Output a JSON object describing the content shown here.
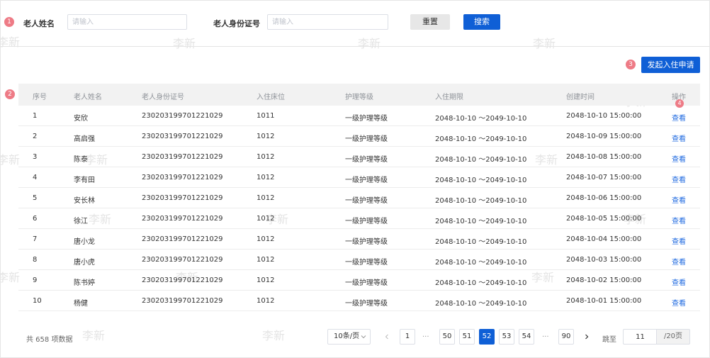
{
  "search": {
    "name_label": "老人姓名",
    "name_placeholder": "请输入",
    "id_label": "老人身份证号",
    "id_placeholder": "请输入",
    "reset_label": "重置",
    "search_label": "搜索"
  },
  "badges": [
    "1",
    "2",
    "3",
    "4"
  ],
  "watermark_text": "李新",
  "apply_button_label": "发起入住申请",
  "table": {
    "headers": [
      "序号",
      "老人姓名",
      "老人身份证号",
      "入住床位",
      "护理等级",
      "入住期限",
      "创建时间",
      "操作"
    ],
    "rows": [
      {
        "no": "1",
        "name": "安欣",
        "id": "230203199701221029",
        "bed": "1011",
        "level": "一级护理等级",
        "term": "2048-10-10 ～2049-10-10",
        "created": "2048-10-10 15:00:00",
        "action": "查看"
      },
      {
        "no": "2",
        "name": "高启强",
        "id": "230203199701221029",
        "bed": "1012",
        "level": "一级护理等级",
        "term": "2048-10-10 ～2049-10-10",
        "created": "2048-10-09 15:00:00",
        "action": "查看"
      },
      {
        "no": "3",
        "name": "陈泰",
        "id": "230203199701221029",
        "bed": "1012",
        "level": "一级护理等级",
        "term": "2048-10-10 ～2049-10-10",
        "created": "2048-10-08 15:00:00",
        "action": "查看"
      },
      {
        "no": "4",
        "name": "李有田",
        "id": "230203199701221029",
        "bed": "1012",
        "level": "一级护理等级",
        "term": "2048-10-10 ～2049-10-10",
        "created": "2048-10-07 15:00:00",
        "action": "查看"
      },
      {
        "no": "5",
        "name": "安长林",
        "id": "230203199701221029",
        "bed": "1012",
        "level": "一级护理等级",
        "term": "2048-10-10 ～2049-10-10",
        "created": "2048-10-06 15:00:00",
        "action": "查看"
      },
      {
        "no": "6",
        "name": "徐江",
        "id": "230203199701221029",
        "bed": "1012",
        "level": "一级护理等级",
        "term": "2048-10-10 ～2049-10-10",
        "created": "2048-10-05 15:00:00",
        "action": "查看"
      },
      {
        "no": "7",
        "name": "唐小龙",
        "id": "230203199701221029",
        "bed": "1012",
        "level": "一级护理等级",
        "term": "2048-10-10 ～2049-10-10",
        "created": "2048-10-04 15:00:00",
        "action": "查看"
      },
      {
        "no": "8",
        "name": "唐小虎",
        "id": "230203199701221029",
        "bed": "1012",
        "level": "一级护理等级",
        "term": "2048-10-10 ～2049-10-10",
        "created": "2048-10-03 15:00:00",
        "action": "查看"
      },
      {
        "no": "9",
        "name": "陈书婷",
        "id": "230203199701221029",
        "bed": "1012",
        "level": "一级护理等级",
        "term": "2048-10-10 ～2049-10-10",
        "created": "2048-10-02 15:00:00",
        "action": "查看"
      },
      {
        "no": "10",
        "name": "杨健",
        "id": "230203199701221029",
        "bed": "1012",
        "level": "一级护理等级",
        "term": "2048-10-10 ～2049-10-10",
        "created": "2048-10-01 15:00:00",
        "action": "查看"
      }
    ]
  },
  "pagination": {
    "total_text": "共 658 项数据",
    "page_size": "10条/页",
    "pages": [
      "1",
      "50",
      "51",
      "52",
      "53",
      "54",
      "90"
    ],
    "current_page": "52",
    "ellipsis": "···",
    "jump_label": "跳至",
    "jump_value": "11",
    "jump_suffix": "/20页"
  },
  "colors": {
    "primary": "#0f5fd6",
    "link": "#1f6ae0",
    "badge": "#ee7b86",
    "header_bg": "#f2f2f2"
  }
}
